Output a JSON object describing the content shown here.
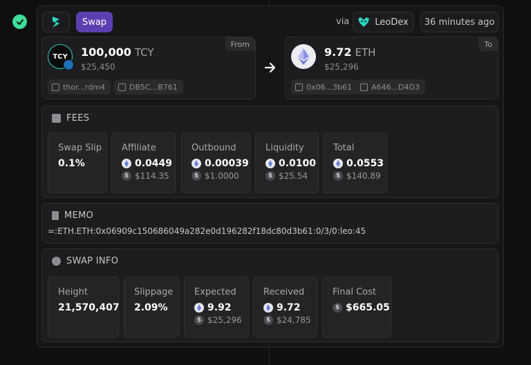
{
  "header": {
    "type_label": "Swap",
    "via_label": "via",
    "source_name": "LeoDex",
    "time_ago": "36 minutes ago"
  },
  "from": {
    "corner": "From",
    "amount": "100,000",
    "ticker": "TCY",
    "logo_text": "TCY",
    "usd": "$25,450",
    "address": "thor...rdm4",
    "tx": "DB5C...B761"
  },
  "to": {
    "corner": "To",
    "amount": "9.72",
    "ticker": "ETH",
    "usd": "$25,296",
    "address": "0x06...3b61",
    "tx": "A646...D4D3"
  },
  "fees": {
    "title": "FEES",
    "items": [
      {
        "label": "Swap Slip",
        "value": "0.1%",
        "usd": ""
      },
      {
        "label": "Affiliate",
        "value": "0.0449",
        "usd": "$114.35"
      },
      {
        "label": "Outbound",
        "value": "0.00039",
        "usd": "$1.0000"
      },
      {
        "label": "Liquidity",
        "value": "0.0100",
        "usd": "$25.54"
      },
      {
        "label": "Total",
        "value": "0.0553",
        "usd": "$140.89"
      }
    ]
  },
  "memo": {
    "title": "MEMO",
    "text": "=:ETH.ETH:0x06909c150686049a282e0d196282f18dc80d3b61:0/3/0:leo:45"
  },
  "swap_info": {
    "title": "SWAP INFO",
    "items": [
      {
        "label": "Height",
        "value": "21,570,407",
        "usd": ""
      },
      {
        "label": "Slippage",
        "value": "2.09%",
        "usd": ""
      },
      {
        "label": "Expected",
        "value": "9.92",
        "usd": "$25,296"
      },
      {
        "label": "Received",
        "value": "9.72",
        "usd": "$24,785"
      },
      {
        "label": "Final Cost",
        "value": "$665.05",
        "usd": ""
      }
    ]
  },
  "colors": {
    "accent_purple": "#5b3fb0",
    "success_green": "#3ddc97",
    "thorchain_teal": "#2fd6c4"
  }
}
